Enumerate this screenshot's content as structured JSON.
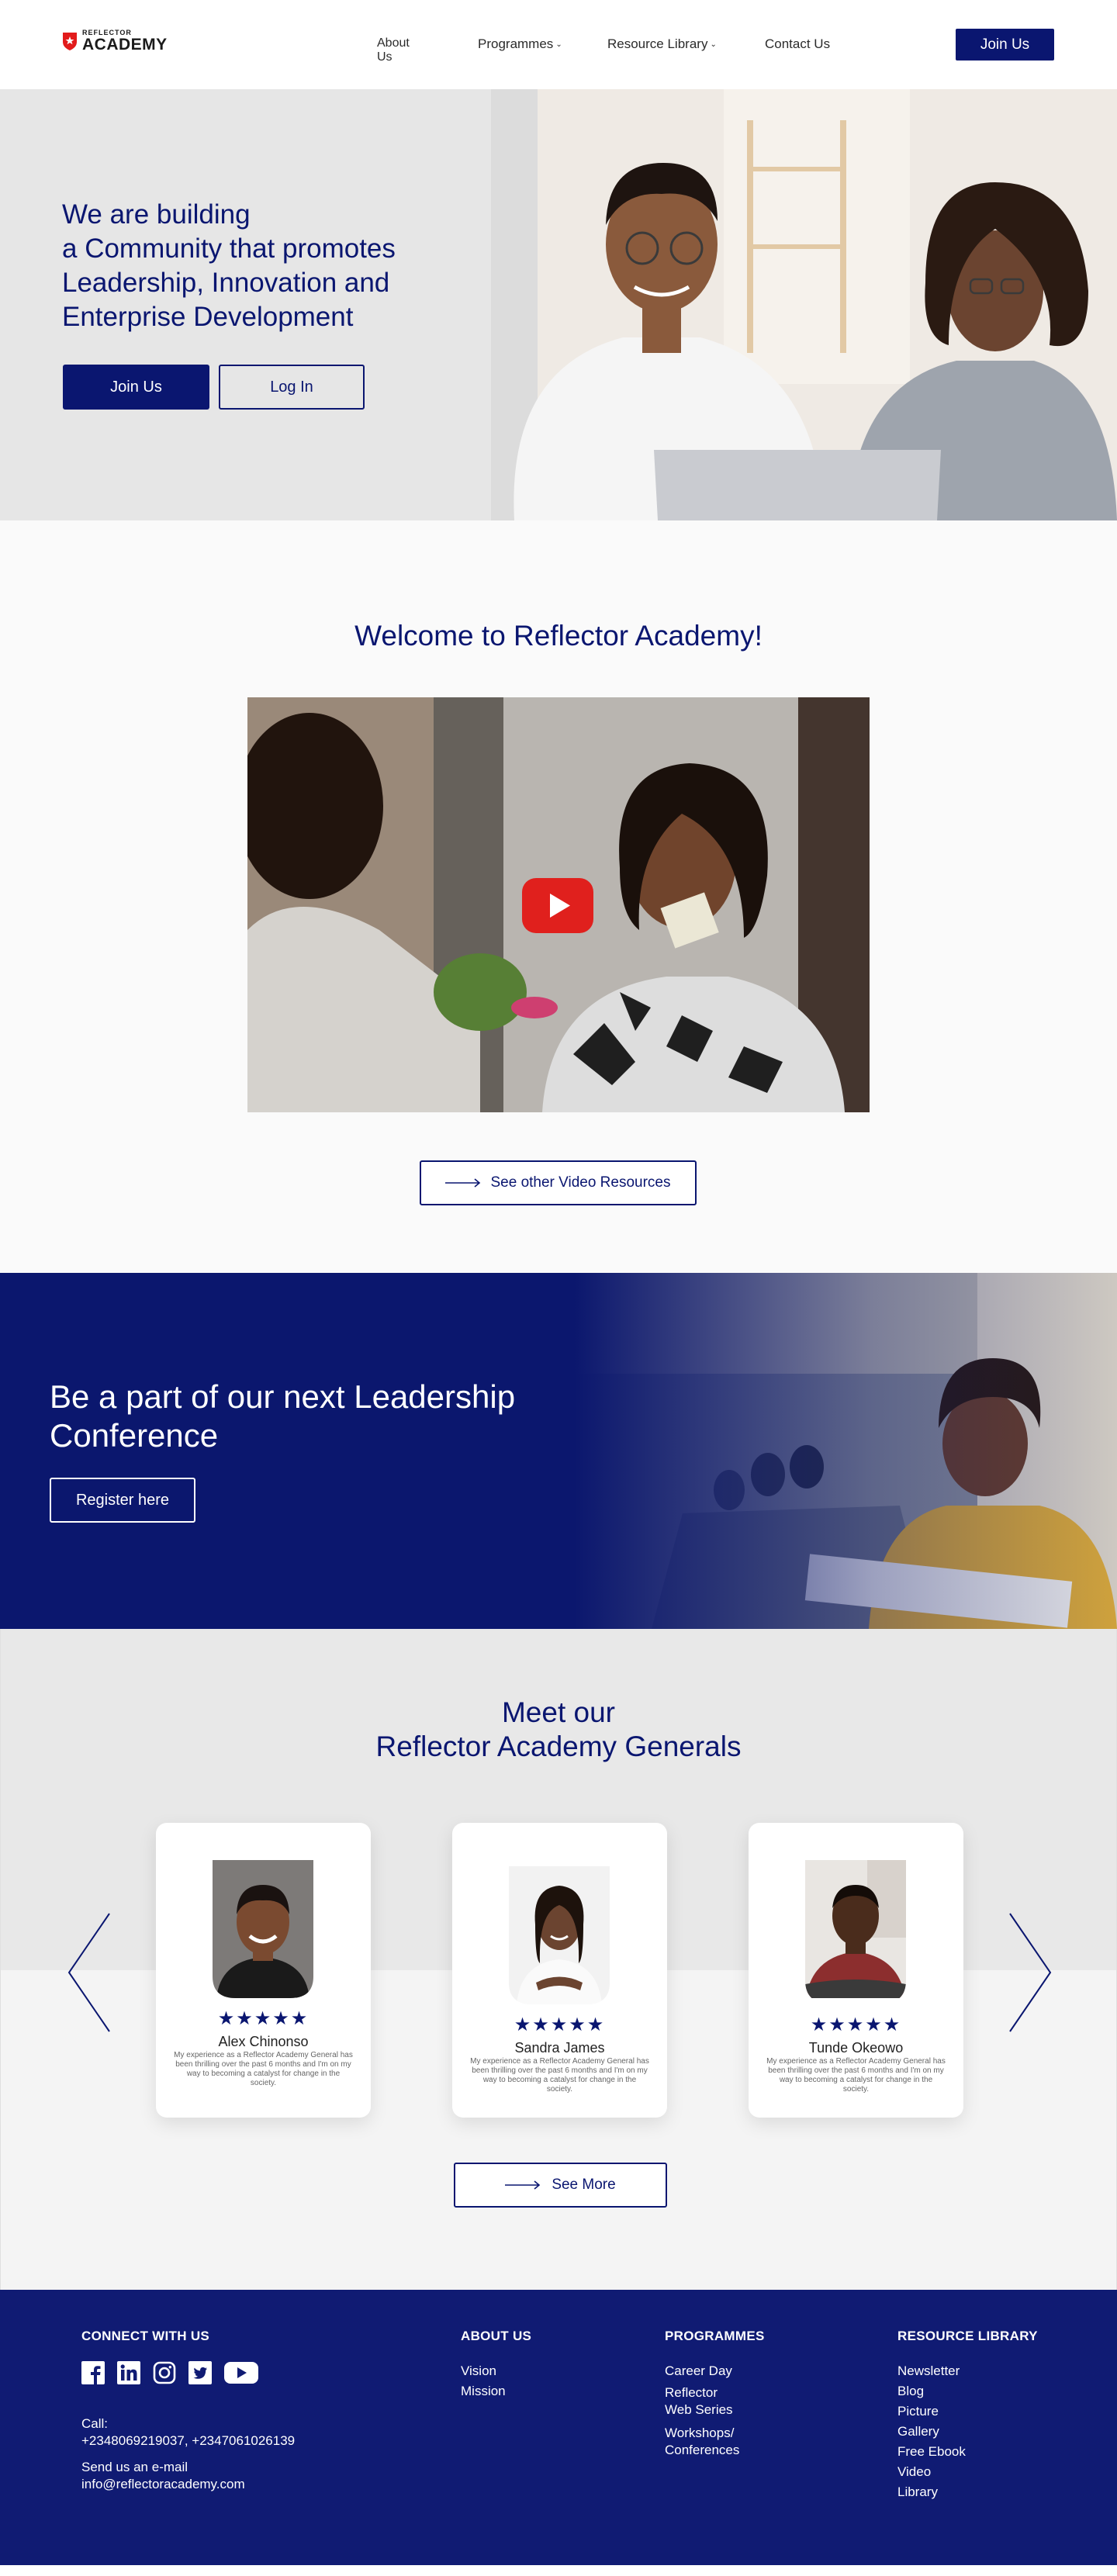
{
  "brand": {
    "logo_small": "REFLECTOR",
    "logo_big": "ACADEMY",
    "accent_color": "#0a1670",
    "logo_color": "#e21b1b"
  },
  "nav": {
    "about": "About Us",
    "programmes": "Programmes",
    "resources": "Resource Library",
    "contact": "Contact Us",
    "join": "Join Us"
  },
  "hero": {
    "title_line1": "We are building",
    "title_rest": "a Community that promotes Leadership, Innovation and Enterprise Development",
    "join": "Join Us",
    "login": "Log In"
  },
  "welcome": {
    "title": "Welcome to Reflector Academy!",
    "video_button": "See other Video Resources",
    "play_icon": "youtube-play-icon"
  },
  "conference": {
    "title": "Be a part of our next Leadership Conference",
    "register": "Register here"
  },
  "generals": {
    "title_line1": "Meet our",
    "title_line2": "Reflector Academy Generals",
    "see_more": "See More",
    "cards": [
      {
        "name": "Alex Chinonso",
        "stars": "★★★★★",
        "rating": 5,
        "quote": "My experience as a Reflector Academy General has been thrilling over the past 6 months and I'm on my way to becoming a catalyst for change in the society."
      },
      {
        "name": "Sandra James",
        "stars": "★★★★★",
        "rating": 5,
        "quote": "My experience as a Reflector Academy General has been thrilling over the past 6 months and I'm on my way to becoming a catalyst for change in the society."
      },
      {
        "name": "Tunde Okeowo",
        "stars": "★★★★★",
        "rating": 5,
        "quote": "My experience as a Reflector Academy General has been thrilling over the past 6 months and I'm on my way to becoming a catalyst for change in the society."
      }
    ]
  },
  "footer": {
    "connect_title": "CONNECT WITH US",
    "social_icons": [
      "facebook-icon",
      "linkedin-icon",
      "instagram-icon",
      "twitter-icon",
      "youtube-icon"
    ],
    "call_label": "Call:",
    "phones": "+2348069219037, +2347061026139",
    "email_label": "Send us an e-mail",
    "email": "info@reflectoracademy.com",
    "about_title": "ABOUT US",
    "about_links": [
      "Vision",
      "Mission"
    ],
    "programmes_title": "PROGRAMMES",
    "programmes_links": [
      "Career Day",
      "Reflector",
      "Web Series",
      "Workshops/",
      "Conferences"
    ],
    "resource_title": "RESOURCE LIBRARY",
    "resource_links": [
      "Newsletter",
      "Blog",
      "Picture",
      "Gallery",
      "Free Ebook",
      "Video",
      "Library"
    ]
  }
}
